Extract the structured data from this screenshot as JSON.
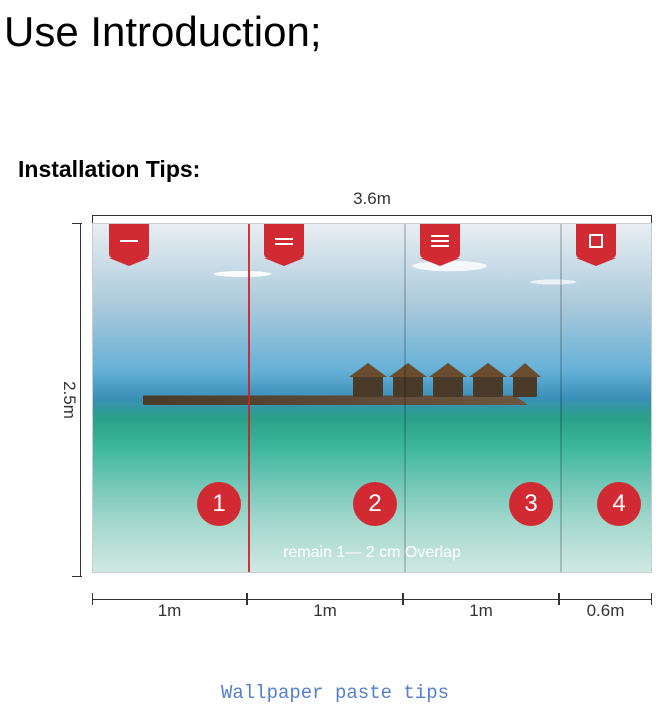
{
  "title": "Use Introduction;",
  "heading": "Installation Tips:",
  "total_width": "3.6m",
  "total_height": "2.5m",
  "panels": [
    {
      "number": "1",
      "tag_bars": 1,
      "width_label": "1m"
    },
    {
      "number": "2",
      "tag_bars": 2,
      "width_label": "1m"
    },
    {
      "number": "3",
      "tag_bars": 3,
      "width_label": "1m"
    },
    {
      "number": "4",
      "tag_bars": 0,
      "width_label": "0.6m"
    }
  ],
  "overlap_text": "remain 1— 2 cm Overlap",
  "caption": "Wallpaper paste tips"
}
